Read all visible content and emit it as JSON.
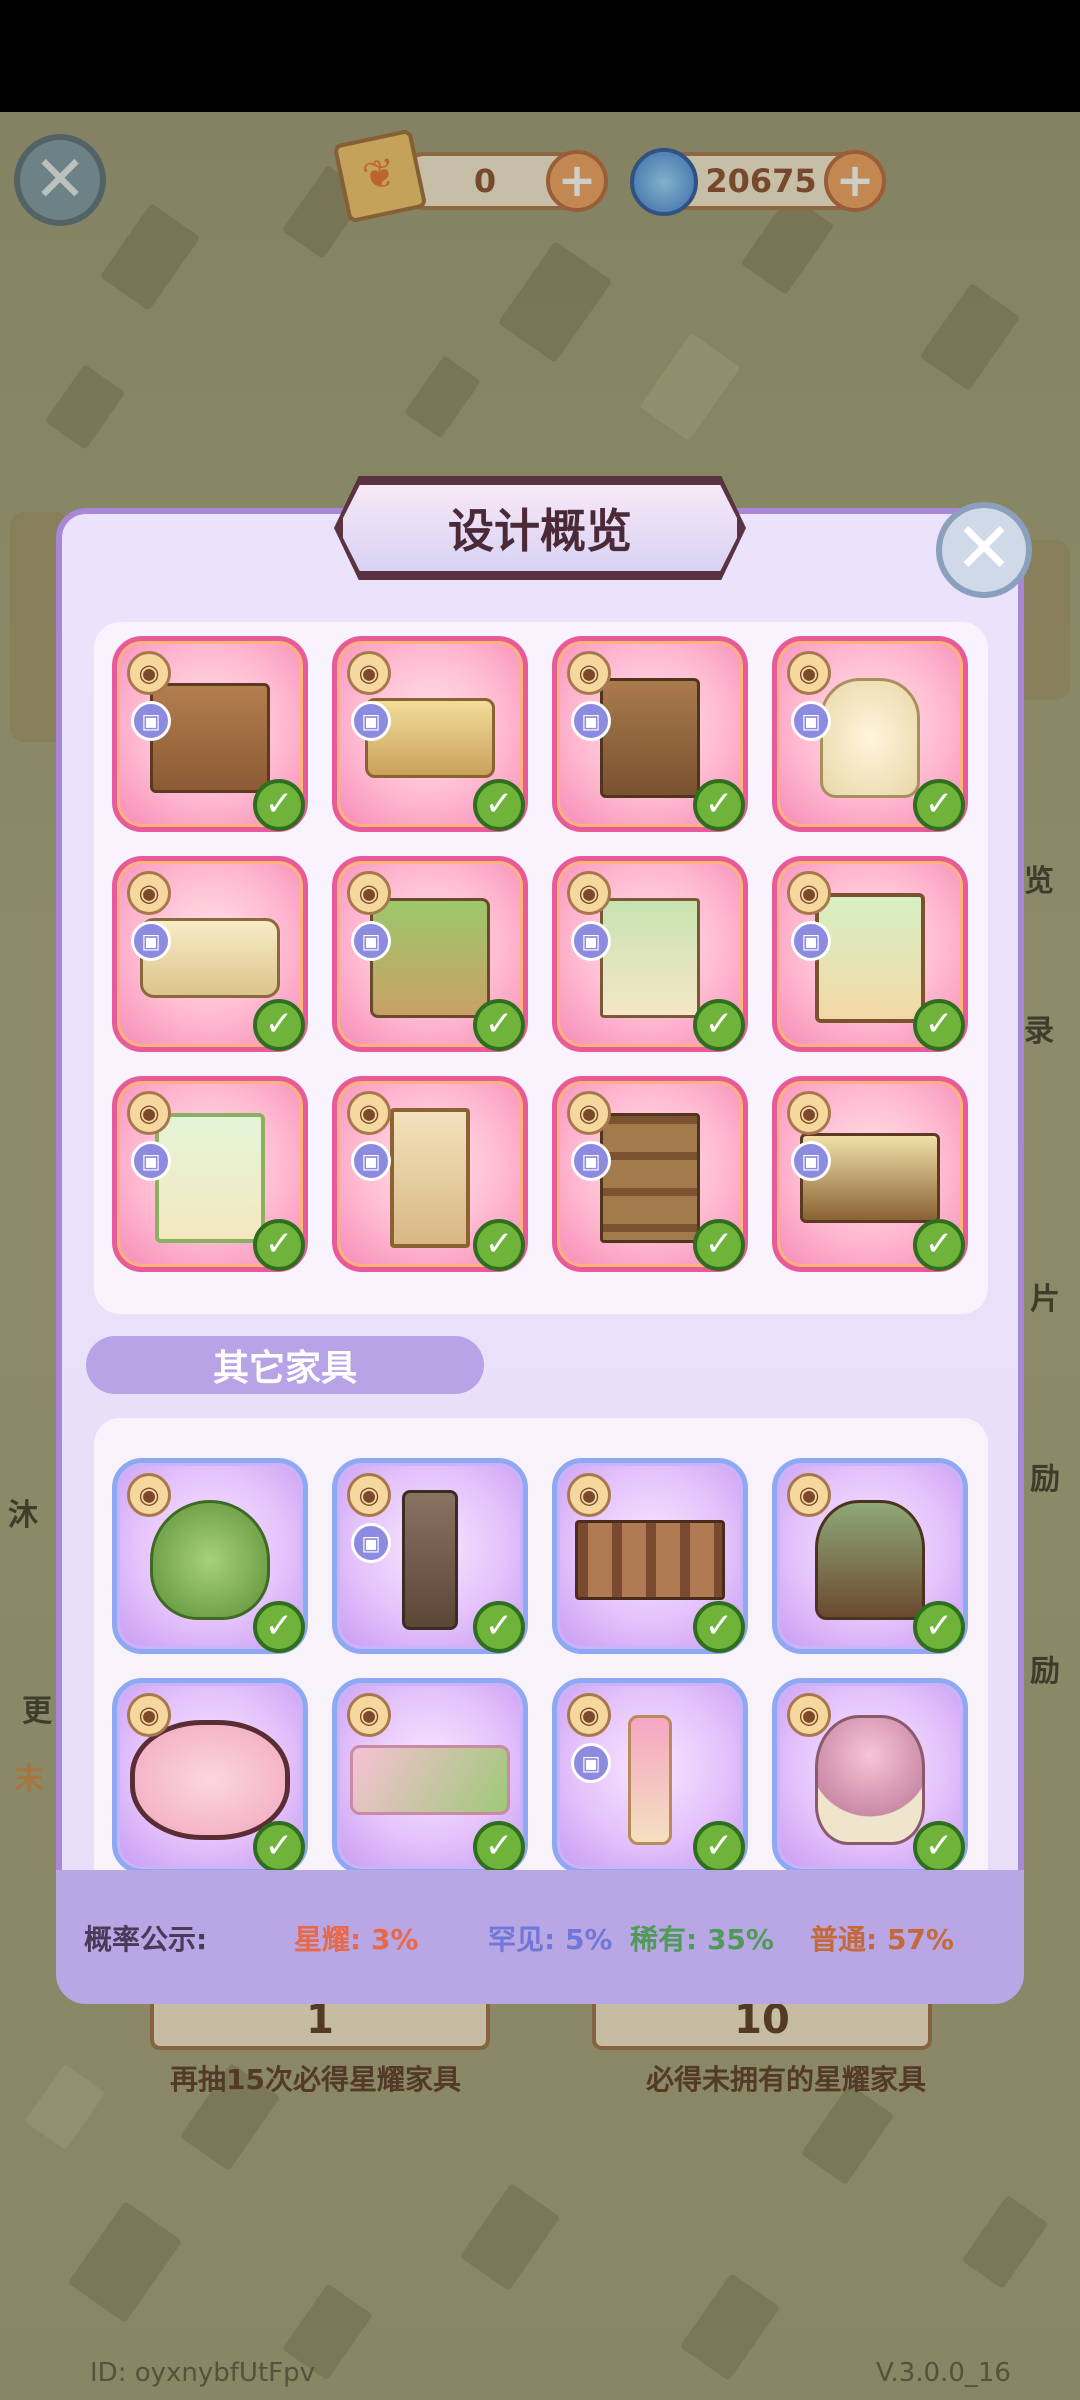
{
  "top_bar": {
    "ticket_count": "0",
    "gem_count": "20675"
  },
  "background": {
    "side_labels": [
      "沐",
      "更",
      "末",
      "览",
      "录",
      "片",
      "励",
      "励"
    ],
    "left_button_count": "1",
    "right_button_count": "10",
    "left_caption": "再抽15次必得星耀家具",
    "right_caption": "必得未拥有的星耀家具"
  },
  "modal": {
    "title": "设计概览",
    "design_items": [
      {
        "icon": "desk-hutch-icon"
      },
      {
        "icon": "bed-icon"
      },
      {
        "icon": "kitchen-cabinet-icon"
      },
      {
        "icon": "armchair-icon"
      },
      {
        "icon": "sofa-icon"
      },
      {
        "icon": "bunk-bed-icon"
      },
      {
        "icon": "easel-icon"
      },
      {
        "icon": "window-nook-icon"
      },
      {
        "icon": "flower-window-icon"
      },
      {
        "icon": "doorway-icon"
      },
      {
        "icon": "bookshelf-icon"
      },
      {
        "icon": "counter-plants-icon"
      }
    ],
    "other_section_label": "其它家具",
    "other_items": [
      {
        "icon": "tree-icon"
      },
      {
        "icon": "stone-lantern-icon"
      },
      {
        "icon": "wooden-screen-icon"
      },
      {
        "icon": "folding-fan-icon"
      },
      {
        "icon": "sakura-rug-icon"
      },
      {
        "icon": "sakura-carpet-icon"
      },
      {
        "icon": "candle-icon"
      },
      {
        "icon": "blossom-vase-icon"
      }
    ],
    "probability": {
      "label": "概率公示:",
      "star": "星耀: 3%",
      "rare": "罕见: 5%",
      "uncommon": "稀有: 35%",
      "common": "普通: 57%"
    },
    "colors": {
      "star": "#e86848",
      "rare": "#6f78d8",
      "uncommon": "#4f9a58",
      "common": "#c46a3a"
    }
  },
  "footer": {
    "user_id": "ID: oyxnybfUtFpv",
    "version": "V.3.0.0_16"
  }
}
